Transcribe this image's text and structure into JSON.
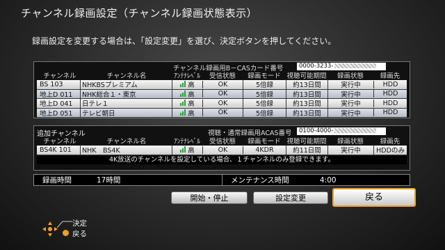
{
  "title": "チャンネル録画設定（チャンネル録画状態表示）",
  "instruction": "録画設定を変更する場合は、「設定変更」を選び、決定ボタンを押してください。",
  "colors": {
    "accent": "#f0a020",
    "signal": "#2ea043"
  },
  "main_table": {
    "cas_label": "チャンネル録画用B－CASカード番号",
    "cas_number": "0000-3233-",
    "headers": [
      "チャンネル",
      "チャンネル名",
      "ｱﾝﾃﾅﾚﾍﾞﾙ",
      "受信状態",
      "録画モード",
      "視聴可能期間",
      "録画状態",
      "録画先"
    ],
    "rows": [
      {
        "channel": "BS 103",
        "name": "NHKBSプレミアム",
        "level": "高",
        "reception": "OK",
        "mode": "5倍録",
        "period": "約13日間",
        "status": "実行中",
        "dest": "HDD"
      },
      {
        "channel": "地上D 011",
        "name": "NHK総合１・東京",
        "level": "高",
        "reception": "OK",
        "mode": "5倍録",
        "period": "約13日間",
        "status": "実行中",
        "dest": "HDD"
      },
      {
        "channel": "地上D 041",
        "name": "日テレ１",
        "level": "高",
        "reception": "OK",
        "mode": "5倍録",
        "period": "約13日間",
        "status": "実行中",
        "dest": "HDD"
      },
      {
        "channel": "地上D 051",
        "name": "テレビ朝日",
        "level": "高",
        "reception": "OK",
        "mode": "5倍録",
        "period": "約13日間",
        "status": "実行中",
        "dest": "HDD"
      }
    ]
  },
  "add_table": {
    "label": "追加チャンネル",
    "acas_label": "視聴・通常録画用ACAS番号",
    "acas_number": "0100-4000-",
    "headers": [
      "チャンネル",
      "チャンネル名",
      "ｱﾝﾃﾅﾚﾍﾞﾙ",
      "受信状態",
      "録画モード",
      "視聴可能期間",
      "録画状態",
      "録画先"
    ],
    "rows": [
      {
        "channel": "BS4K 101",
        "name": "NHK　BS4K",
        "level": "高",
        "reception": "OK",
        "mode": "4KDR",
        "period": "約11日間",
        "status": "実行中",
        "dest": "HDDのみ"
      }
    ],
    "note": "4K放送のチャンネルを設定している場合、１チャンネルのみ登録できます。"
  },
  "info": {
    "rec_time_label": "録画時間",
    "rec_time_value": "17時間",
    "maint_label": "メンテナンス時間",
    "maint_value": "4:00"
  },
  "buttons": {
    "start_stop": "開始・停止",
    "settings_change": "設定変更",
    "back": "戻る"
  },
  "legend": {
    "confirm": "決定",
    "back": "戻る"
  }
}
